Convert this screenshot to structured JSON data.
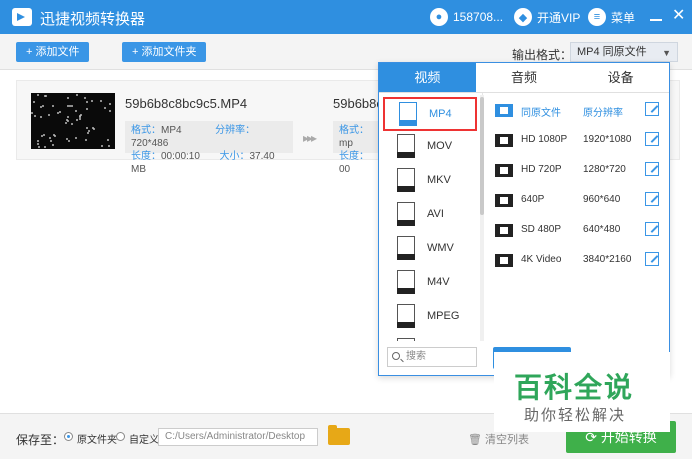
{
  "app": {
    "title": "迅捷视频转换器",
    "user_id": "158708...",
    "vip_label": "开通VIP",
    "menu_label": "菜单"
  },
  "toolbar": {
    "add_file": "+ 添加文件",
    "add_folder": "+ 添加文件夹",
    "output_format_label": "输出格式：",
    "output_format_value": "MP4  同原文件"
  },
  "file": {
    "name": "59b6b8c8bc9c5.MP4",
    "name_right": "59b6b8c",
    "format_key": "格式：",
    "format_val": "MP4",
    "resolution_key": "分辨率：",
    "resolution_val": "720*486",
    "duration_key": "长度：",
    "duration_val": "00:00:10",
    "size_key": "大小：",
    "size_val": "37.40 MB",
    "right_format_key": "格式：",
    "right_format_val": "mp",
    "right_duration_key": "长度：",
    "right_duration_val": "00"
  },
  "popup": {
    "tabs": [
      "视频",
      "音频",
      "设备"
    ],
    "formats": [
      "MP4",
      "MOV",
      "MKV",
      "AVI",
      "WMV",
      "M4V",
      "MPEG"
    ],
    "resolutions": [
      {
        "name": "同原文件",
        "value": "原分辨率"
      },
      {
        "name": "HD 1080P",
        "value": "1920*1080"
      },
      {
        "name": "HD 720P",
        "value": "1280*720"
      },
      {
        "name": "640P",
        "value": "960*640"
      },
      {
        "name": "SD 480P",
        "value": "640*480"
      },
      {
        "name": "4K Video",
        "value": "3840*2160"
      }
    ],
    "search_placeholder": "搜索"
  },
  "bottom": {
    "save_to": "保存至：",
    "opt_source": "原文件夹",
    "opt_custom": "自定义",
    "path": "C:/Users/Administrator/Desktop",
    "clear_list": "清空列表",
    "start": "开始转换"
  },
  "watermark": {
    "title": "百科全说",
    "subtitle": "助你轻松解决"
  },
  "colors": {
    "brand_blue": "#2f8fe0",
    "start_green": "#3fb04a",
    "selected_border": "#ee3333"
  }
}
